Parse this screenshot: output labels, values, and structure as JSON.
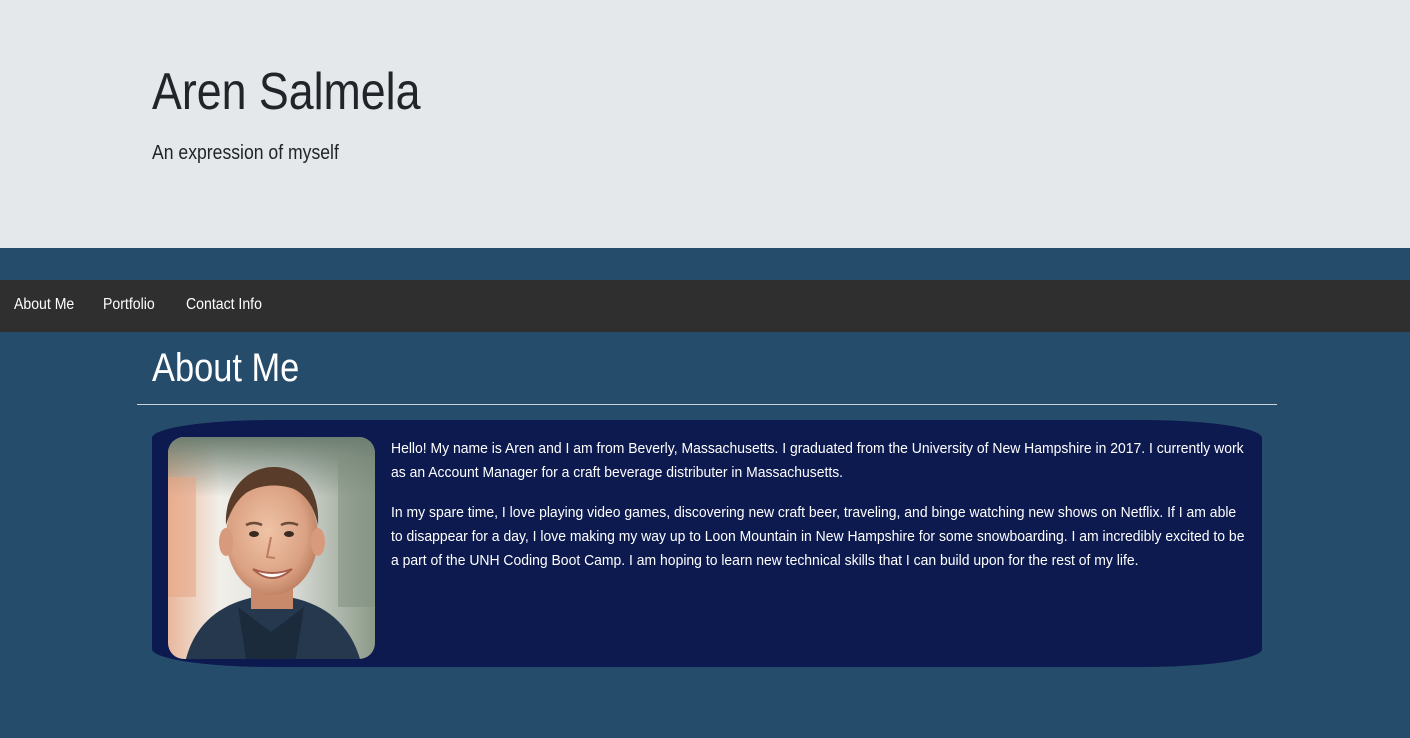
{
  "header": {
    "title": "Aren Salmela",
    "subtitle": "An expression of myself"
  },
  "nav": {
    "items": [
      {
        "label": "About Me"
      },
      {
        "label": "Portfolio"
      },
      {
        "label": "Contact Info"
      }
    ]
  },
  "about": {
    "heading": "About Me",
    "paragraph_1": "Hello! My name is Aren and I am from Beverly, Massachusetts. I graduated from the University of New Hampshire in 2017. I currently work as an Account Manager for a craft beverage distributer in Massachusetts.",
    "paragraph_2": "In my spare time, I love playing video games, discovering new craft beer, traveling, and binge watching new shows on Netflix. If I am able to disappear for a day, I love making my way up to Loon Mountain in New Hampshire for some snowboarding. I am incredibly excited to be a part of the UNH Coding Boot Camp. I am hoping to learn new technical skills that I can build upon for the rest of my life."
  },
  "colors": {
    "jumbotron_bg": "#e4e8eb",
    "page_bg": "#264c6b",
    "navbar_bg": "#2f2f2f",
    "card_bg": "#0c1a4f",
    "text_dark": "#212529",
    "text_light": "#ffffff"
  }
}
